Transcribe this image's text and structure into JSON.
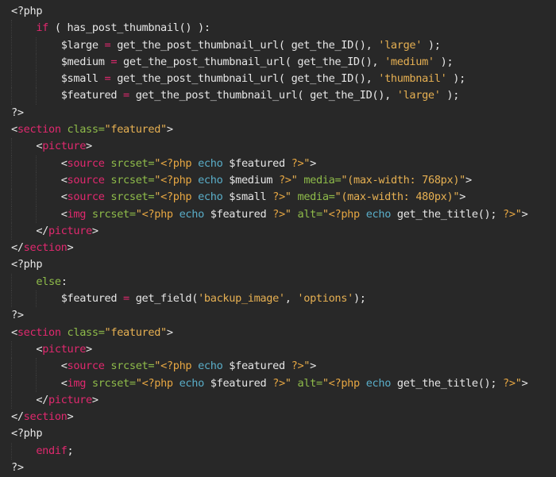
{
  "editor": {
    "theme_colors": {
      "background": "#282828",
      "text": "#e6e6e6",
      "keyword": "#e0286e",
      "attribute": "#8fbc4a",
      "string": "#e6b052",
      "function_call": "#5aaec9"
    },
    "lines": [
      {
        "indent": 0,
        "tokens": [
          {
            "t": "text",
            "v": "<?php"
          }
        ]
      },
      {
        "indent": 1,
        "tokens": [
          {
            "t": "kw",
            "v": "if"
          },
          {
            "t": "text",
            "v": " ( has_post_thumbnail() ):"
          }
        ]
      },
      {
        "indent": 2,
        "tokens": [
          {
            "t": "text",
            "v": "$large "
          },
          {
            "t": "op",
            "v": "="
          },
          {
            "t": "text",
            "v": " get_the_post_thumbnail_url( get_the_ID(), "
          },
          {
            "t": "str",
            "v": "'large'"
          },
          {
            "t": "text",
            "v": " );"
          }
        ]
      },
      {
        "indent": 2,
        "tokens": [
          {
            "t": "text",
            "v": "$medium "
          },
          {
            "t": "op",
            "v": "="
          },
          {
            "t": "text",
            "v": " get_the_post_thumbnail_url( get_the_ID(), "
          },
          {
            "t": "str",
            "v": "'medium'"
          },
          {
            "t": "text",
            "v": " );"
          }
        ]
      },
      {
        "indent": 2,
        "tokens": [
          {
            "t": "text",
            "v": "$small "
          },
          {
            "t": "op",
            "v": "="
          },
          {
            "t": "text",
            "v": " get_the_post_thumbnail_url( get_the_ID(), "
          },
          {
            "t": "str",
            "v": "'thumbnail'"
          },
          {
            "t": "text",
            "v": " );"
          }
        ]
      },
      {
        "indent": 2,
        "tokens": [
          {
            "t": "text",
            "v": "$featured "
          },
          {
            "t": "op",
            "v": "="
          },
          {
            "t": "text",
            "v": " get_the_post_thumbnail_url( get_the_ID(), "
          },
          {
            "t": "str",
            "v": "'large'"
          },
          {
            "t": "text",
            "v": " );"
          }
        ]
      },
      {
        "indent": 0,
        "tokens": [
          {
            "t": "text",
            "v": "?>"
          }
        ]
      },
      {
        "indent": 0,
        "tokens": [
          {
            "t": "punct",
            "v": "<"
          },
          {
            "t": "tag",
            "v": "section"
          },
          {
            "t": "text",
            "v": " "
          },
          {
            "t": "attr",
            "v": "class="
          },
          {
            "t": "str",
            "v": "\"featured\""
          },
          {
            "t": "punct",
            "v": ">"
          }
        ]
      },
      {
        "indent": 1,
        "tokens": [
          {
            "t": "punct",
            "v": "<"
          },
          {
            "t": "tag",
            "v": "picture"
          },
          {
            "t": "punct",
            "v": ">"
          }
        ]
      },
      {
        "indent": 2,
        "tokens": [
          {
            "t": "punct",
            "v": "<"
          },
          {
            "t": "tag",
            "v": "source"
          },
          {
            "t": "text",
            "v": " "
          },
          {
            "t": "attr",
            "v": "srcset="
          },
          {
            "t": "str",
            "v": "\""
          },
          {
            "t": "php",
            "v": "<?php"
          },
          {
            "t": "text",
            "v": " "
          },
          {
            "t": "echo",
            "v": "echo"
          },
          {
            "t": "text",
            "v": " $featured "
          },
          {
            "t": "php",
            "v": "?>"
          },
          {
            "t": "str",
            "v": "\""
          },
          {
            "t": "punct",
            "v": ">"
          }
        ]
      },
      {
        "indent": 2,
        "tokens": [
          {
            "t": "punct",
            "v": "<"
          },
          {
            "t": "tag",
            "v": "source"
          },
          {
            "t": "text",
            "v": " "
          },
          {
            "t": "attr",
            "v": "srcset="
          },
          {
            "t": "str",
            "v": "\""
          },
          {
            "t": "php",
            "v": "<?php"
          },
          {
            "t": "text",
            "v": " "
          },
          {
            "t": "echo",
            "v": "echo"
          },
          {
            "t": "text",
            "v": " $medium "
          },
          {
            "t": "php",
            "v": "?>"
          },
          {
            "t": "str",
            "v": "\""
          },
          {
            "t": "text",
            "v": " "
          },
          {
            "t": "attr",
            "v": "media="
          },
          {
            "t": "str",
            "v": "\"(max-width: 768px)\""
          },
          {
            "t": "punct",
            "v": ">"
          }
        ]
      },
      {
        "indent": 2,
        "tokens": [
          {
            "t": "punct",
            "v": "<"
          },
          {
            "t": "tag",
            "v": "source"
          },
          {
            "t": "text",
            "v": " "
          },
          {
            "t": "attr",
            "v": "srcset="
          },
          {
            "t": "str",
            "v": "\""
          },
          {
            "t": "php",
            "v": "<?php"
          },
          {
            "t": "text",
            "v": " "
          },
          {
            "t": "echo",
            "v": "echo"
          },
          {
            "t": "text",
            "v": " $small "
          },
          {
            "t": "php",
            "v": "?>"
          },
          {
            "t": "str",
            "v": "\""
          },
          {
            "t": "text",
            "v": " "
          },
          {
            "t": "attr",
            "v": "media="
          },
          {
            "t": "str",
            "v": "\"(max-width: 480px)\""
          },
          {
            "t": "punct",
            "v": ">"
          }
        ]
      },
      {
        "indent": 2,
        "tokens": [
          {
            "t": "punct",
            "v": "<"
          },
          {
            "t": "tag",
            "v": "img"
          },
          {
            "t": "text",
            "v": " "
          },
          {
            "t": "attr",
            "v": "srcset="
          },
          {
            "t": "str",
            "v": "\""
          },
          {
            "t": "php",
            "v": "<?php"
          },
          {
            "t": "text",
            "v": " "
          },
          {
            "t": "echo",
            "v": "echo"
          },
          {
            "t": "text",
            "v": " $featured "
          },
          {
            "t": "php",
            "v": "?>"
          },
          {
            "t": "str",
            "v": "\""
          },
          {
            "t": "text",
            "v": " "
          },
          {
            "t": "attr",
            "v": "alt="
          },
          {
            "t": "str",
            "v": "\""
          },
          {
            "t": "php",
            "v": "<?php"
          },
          {
            "t": "text",
            "v": " "
          },
          {
            "t": "echo",
            "v": "echo"
          },
          {
            "t": "text",
            "v": " get_the_title(); "
          },
          {
            "t": "php",
            "v": "?>"
          },
          {
            "t": "str",
            "v": "\""
          },
          {
            "t": "punct",
            "v": ">"
          }
        ]
      },
      {
        "indent": 1,
        "tokens": [
          {
            "t": "punct",
            "v": "</"
          },
          {
            "t": "tag",
            "v": "picture"
          },
          {
            "t": "punct",
            "v": ">"
          }
        ]
      },
      {
        "indent": 0,
        "tokens": [
          {
            "t": "punct",
            "v": "</"
          },
          {
            "t": "tag",
            "v": "section"
          },
          {
            "t": "punct",
            "v": ">"
          }
        ]
      },
      {
        "indent": 0,
        "tokens": [
          {
            "t": "text",
            "v": "<?php"
          }
        ]
      },
      {
        "indent": 1,
        "tokens": [
          {
            "t": "attr",
            "v": "else"
          },
          {
            "t": "text",
            "v": ":"
          }
        ]
      },
      {
        "indent": 2,
        "tokens": [
          {
            "t": "text",
            "v": "$featured "
          },
          {
            "t": "op",
            "v": "="
          },
          {
            "t": "text",
            "v": " get_field("
          },
          {
            "t": "str",
            "v": "'backup_image'"
          },
          {
            "t": "text",
            "v": ", "
          },
          {
            "t": "str",
            "v": "'options'"
          },
          {
            "t": "text",
            "v": ");"
          }
        ]
      },
      {
        "indent": 0,
        "tokens": [
          {
            "t": "text",
            "v": "?>"
          }
        ]
      },
      {
        "indent": 0,
        "tokens": [
          {
            "t": "punct",
            "v": "<"
          },
          {
            "t": "tag",
            "v": "section"
          },
          {
            "t": "text",
            "v": " "
          },
          {
            "t": "attr",
            "v": "class="
          },
          {
            "t": "str",
            "v": "\"featured\""
          },
          {
            "t": "punct",
            "v": ">"
          }
        ]
      },
      {
        "indent": 1,
        "tokens": [
          {
            "t": "punct",
            "v": "<"
          },
          {
            "t": "tag",
            "v": "picture"
          },
          {
            "t": "punct",
            "v": ">"
          }
        ]
      },
      {
        "indent": 2,
        "tokens": [
          {
            "t": "punct",
            "v": "<"
          },
          {
            "t": "tag",
            "v": "source"
          },
          {
            "t": "text",
            "v": " "
          },
          {
            "t": "attr",
            "v": "srcset="
          },
          {
            "t": "str",
            "v": "\""
          },
          {
            "t": "php",
            "v": "<?php"
          },
          {
            "t": "text",
            "v": " "
          },
          {
            "t": "echo",
            "v": "echo"
          },
          {
            "t": "text",
            "v": " $featured "
          },
          {
            "t": "php",
            "v": "?>"
          },
          {
            "t": "str",
            "v": "\""
          },
          {
            "t": "punct",
            "v": ">"
          }
        ]
      },
      {
        "indent": 2,
        "tokens": [
          {
            "t": "punct",
            "v": "<"
          },
          {
            "t": "tag",
            "v": "img"
          },
          {
            "t": "text",
            "v": " "
          },
          {
            "t": "attr",
            "v": "srcset="
          },
          {
            "t": "str",
            "v": "\""
          },
          {
            "t": "php",
            "v": "<?php"
          },
          {
            "t": "text",
            "v": " "
          },
          {
            "t": "echo",
            "v": "echo"
          },
          {
            "t": "text",
            "v": " $featured "
          },
          {
            "t": "php",
            "v": "?>"
          },
          {
            "t": "str",
            "v": "\""
          },
          {
            "t": "text",
            "v": " "
          },
          {
            "t": "attr",
            "v": "alt="
          },
          {
            "t": "str",
            "v": "\""
          },
          {
            "t": "php",
            "v": "<?php"
          },
          {
            "t": "text",
            "v": " "
          },
          {
            "t": "echo",
            "v": "echo"
          },
          {
            "t": "text",
            "v": " get_the_title(); "
          },
          {
            "t": "php",
            "v": "?>"
          },
          {
            "t": "str",
            "v": "\""
          },
          {
            "t": "punct",
            "v": ">"
          }
        ]
      },
      {
        "indent": 1,
        "tokens": [
          {
            "t": "punct",
            "v": "</"
          },
          {
            "t": "tag",
            "v": "picture"
          },
          {
            "t": "punct",
            "v": ">"
          }
        ]
      },
      {
        "indent": 0,
        "tokens": [
          {
            "t": "punct",
            "v": "</"
          },
          {
            "t": "tag",
            "v": "section"
          },
          {
            "t": "punct",
            "v": ">"
          }
        ]
      },
      {
        "indent": 0,
        "tokens": [
          {
            "t": "text",
            "v": "<?php"
          }
        ]
      },
      {
        "indent": 1,
        "tokens": [
          {
            "t": "kw",
            "v": "endif"
          },
          {
            "t": "text",
            "v": ";"
          }
        ]
      },
      {
        "indent": 0,
        "tokens": [
          {
            "t": "text",
            "v": "?>"
          }
        ]
      }
    ]
  }
}
